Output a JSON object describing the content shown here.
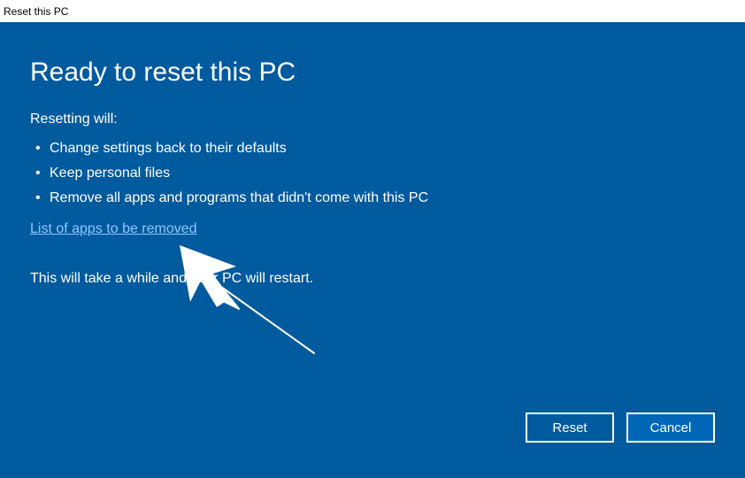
{
  "window": {
    "title": "Reset this PC"
  },
  "main": {
    "heading": "Ready to reset this PC",
    "subhead": "Resetting will:",
    "bullets": [
      "Change settings back to their defaults",
      "Keep personal files",
      "Remove all apps and programs that didn't come with this PC"
    ],
    "link": "List of apps to be removed",
    "info": "This will take a while and your PC will restart."
  },
  "buttons": {
    "reset": "Reset",
    "cancel": "Cancel"
  }
}
